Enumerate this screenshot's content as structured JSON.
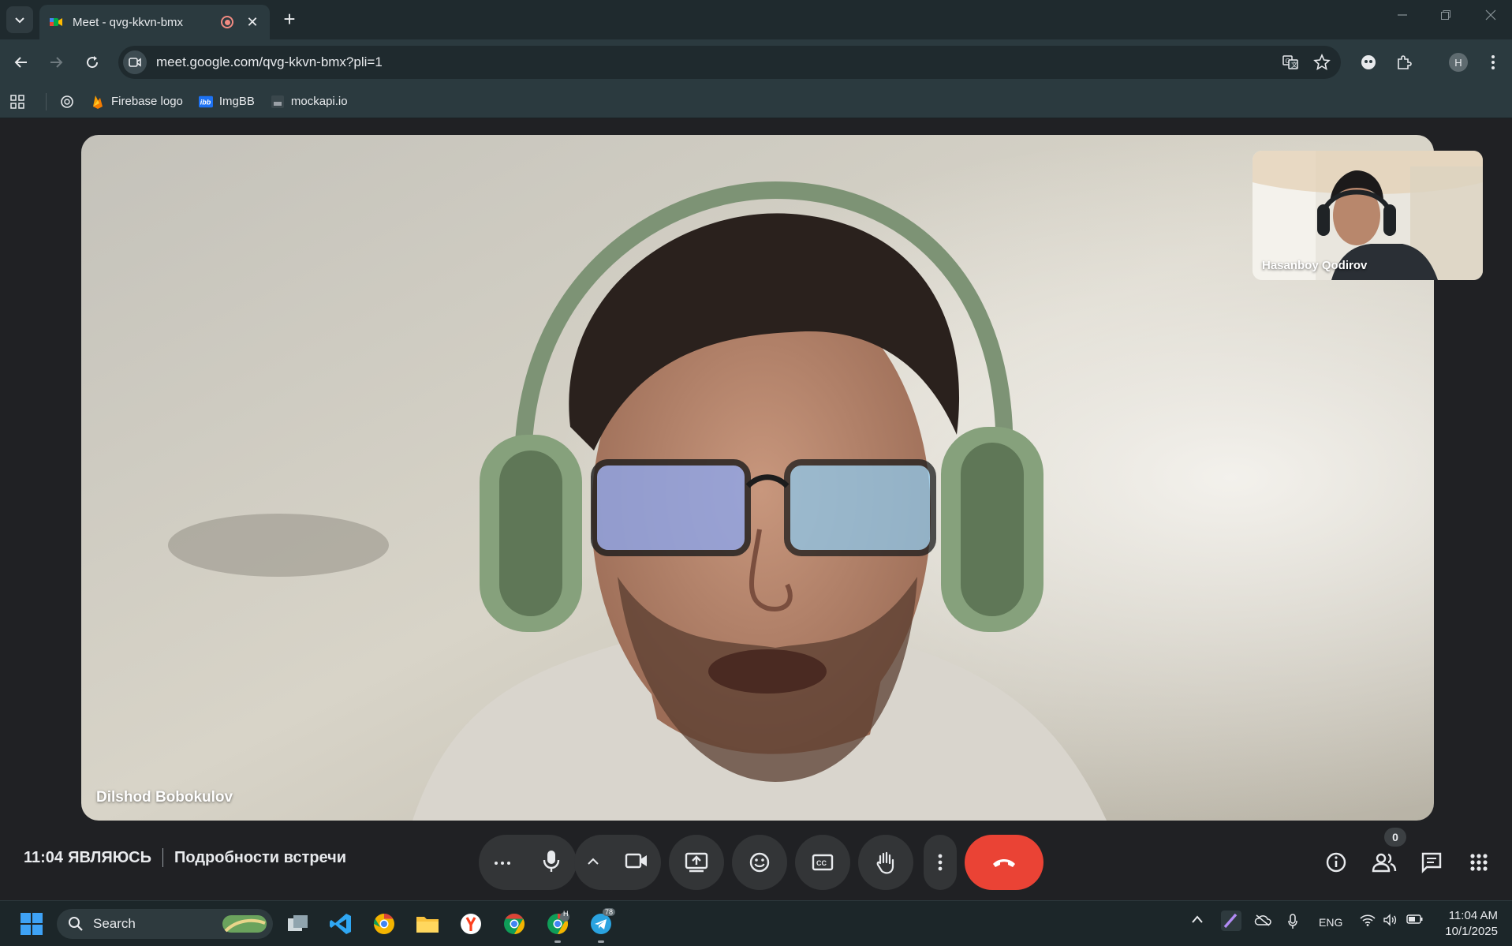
{
  "browser": {
    "tab_title": "Meet - qvg-kkvn-bmx",
    "new_tab_symbol": "+",
    "close_symbol": "✕",
    "url": "meet.google.com/qvg-kkvn-bmx?pli=1",
    "profile_initial": "H",
    "bookmarks": [
      {
        "label": "Firebase logo",
        "icon": "firebase-icon"
      },
      {
        "label": "ImgBB",
        "icon": "imgbb-icon"
      },
      {
        "label": "mockapi.io",
        "icon": "mockapi-icon"
      }
    ]
  },
  "meeting": {
    "main_participant": "Dilshod Bobokulov",
    "self_participant": "Hasanboy Qodirov",
    "time": "11:04",
    "status": "ЯВЛЯЮСЬ",
    "details_label": "Подробности встречи",
    "participants_badge": "0"
  },
  "taskbar": {
    "search_label": "Search",
    "language": "ENG",
    "time": "11:04 AM",
    "date": "10/1/2025",
    "telegram_badge": "78",
    "chrome_profile_badge": "H"
  },
  "colors": {
    "end_call": "#ea4335",
    "control_bg": "#333537",
    "chrome_frame": "#2b3a3f",
    "meet_bg": "#202124"
  }
}
